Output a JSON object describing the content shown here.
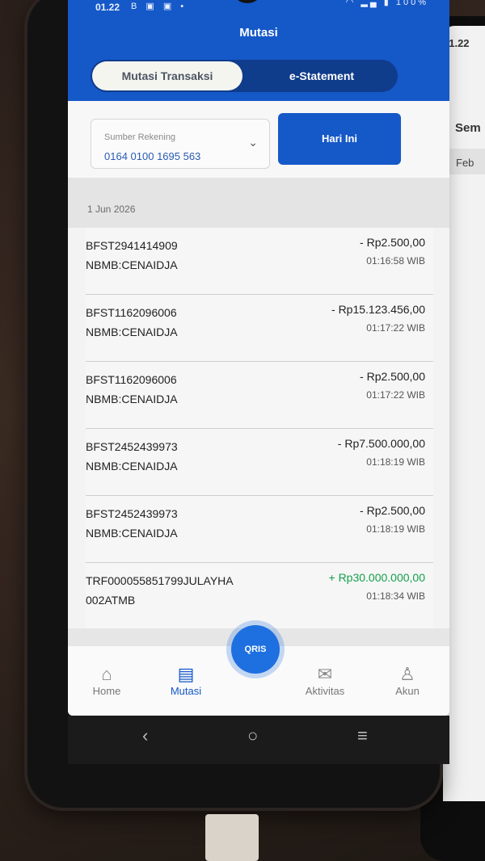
{
  "status_bar": {
    "time": "01.22",
    "left_icons": "B ▣ ▣ •",
    "battery": "100%"
  },
  "header": {
    "title": "Mutasi"
  },
  "tabs": [
    {
      "label": "Mutasi Transaksi",
      "active": true
    },
    {
      "label": "e-Statement",
      "active": false
    }
  ],
  "filter": {
    "account_label": "Sumber Rekening",
    "account_number": "0164 0100 1695 563",
    "period_button": "Hari Ini"
  },
  "date_header": "1 Jun 2026",
  "transactions": [
    {
      "ref": "BFST2941414909",
      "desc": "NBMB:CENAIDJA",
      "amount": "- Rp2.500,00",
      "time": "01:16:58 WIB",
      "type": "debit"
    },
    {
      "ref": "BFST1162096006",
      "desc": "NBMB:CENAIDJA",
      "amount": "- Rp15.123.456,00",
      "time": "01:17:22 WIB",
      "type": "debit"
    },
    {
      "ref": "BFST1162096006",
      "desc": "NBMB:CENAIDJA",
      "amount": "- Rp2.500,00",
      "time": "01:17:22 WIB",
      "type": "debit"
    },
    {
      "ref": "BFST2452439973",
      "desc": "NBMB:CENAIDJA",
      "amount": "- Rp7.500.000,00",
      "time": "01:18:19 WIB",
      "type": "debit"
    },
    {
      "ref": "BFST2452439973",
      "desc": "NBMB:CENAIDJA",
      "amount": "- Rp2.500,00",
      "time": "01:18:19 WIB",
      "type": "debit"
    },
    {
      "ref": "TRF000055851799JULAYHA",
      "desc": "002ATMB",
      "amount": "+ Rp30.000.000,00",
      "time": "01:18:34 WIB",
      "type": "credit"
    }
  ],
  "bottom_nav": {
    "items": [
      {
        "label": "Home",
        "icon": "home-icon"
      },
      {
        "label": "Mutasi",
        "icon": "document-icon",
        "active": true
      },
      {
        "label": "Aktivitas",
        "icon": "mail-icon"
      },
      {
        "label": "Akun",
        "icon": "user-icon"
      }
    ],
    "qris_label": "QRIS"
  },
  "second_phone": {
    "time": "01.22",
    "title": "Sem",
    "chip": "Feb"
  },
  "colors": {
    "primary": "#1558c8",
    "credit": "#13a04a"
  }
}
